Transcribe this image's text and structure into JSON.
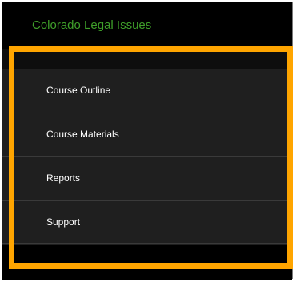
{
  "header": {
    "title": "Colorado Legal Issues"
  },
  "menu": {
    "items": [
      {
        "label": "Course Outline"
      },
      {
        "label": "Course Materials"
      },
      {
        "label": "Reports"
      },
      {
        "label": "Support"
      }
    ]
  },
  "colors": {
    "title_green": "#3f9f2a",
    "highlight_orange": "#ffa500",
    "menu_background": "#1f1f1f",
    "header_background": "#000000"
  }
}
